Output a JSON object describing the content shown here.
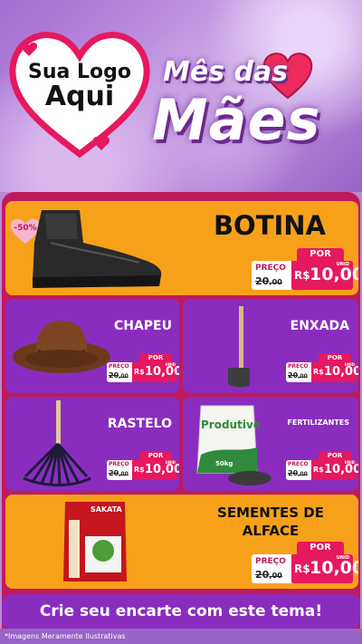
{
  "header": {
    "logo": {
      "line1": "Sua Logo",
      "line2": "Aqui"
    },
    "title_line1": "Mês das",
    "title_line2": "Mães"
  },
  "colors": {
    "accent": "#e6185f",
    "orange": "#f7a11a",
    "purple": "#8a2dbf",
    "frame": "#c01a5c"
  },
  "discount_badge": "-50%",
  "price_labels": {
    "por": "POR",
    "preco": "PREÇO",
    "currency": "R$",
    "unit": "UNID"
  },
  "products": [
    {
      "name": "BOTINA",
      "old_price": "20",
      "old_cents": ",00",
      "new_price": "10,00",
      "icon": "boot-icon"
    },
    {
      "name": "CHAPEU",
      "old_price": "20",
      "old_cents": ",00",
      "new_price": "10,00",
      "icon": "hat-icon"
    },
    {
      "name": "ENXADA",
      "old_price": "20",
      "old_cents": ",00",
      "new_price": "10,00",
      "icon": "hoe-icon"
    },
    {
      "name": "RASTELO",
      "old_price": "20",
      "old_cents": ",00",
      "new_price": "10,00",
      "icon": "rake-icon"
    },
    {
      "name": "FERTILIZANTES",
      "old_price": "20",
      "old_cents": ",00",
      "new_price": "10,00",
      "icon": "fertilizer-bag-icon",
      "bag_brand": "Produtive",
      "bag_weight": "50kg"
    },
    {
      "name_line1": "SEMENTES DE",
      "name_line2": "ALFACE",
      "old_price": "20",
      "old_cents": ",00",
      "new_price": "10,00",
      "icon": "seed-packet-icon",
      "packet_brand": "SAKATA"
    }
  ],
  "cta": "Crie seu encarte com este tema!",
  "footer_note": "*Imagens Meramente Ilustrativas"
}
